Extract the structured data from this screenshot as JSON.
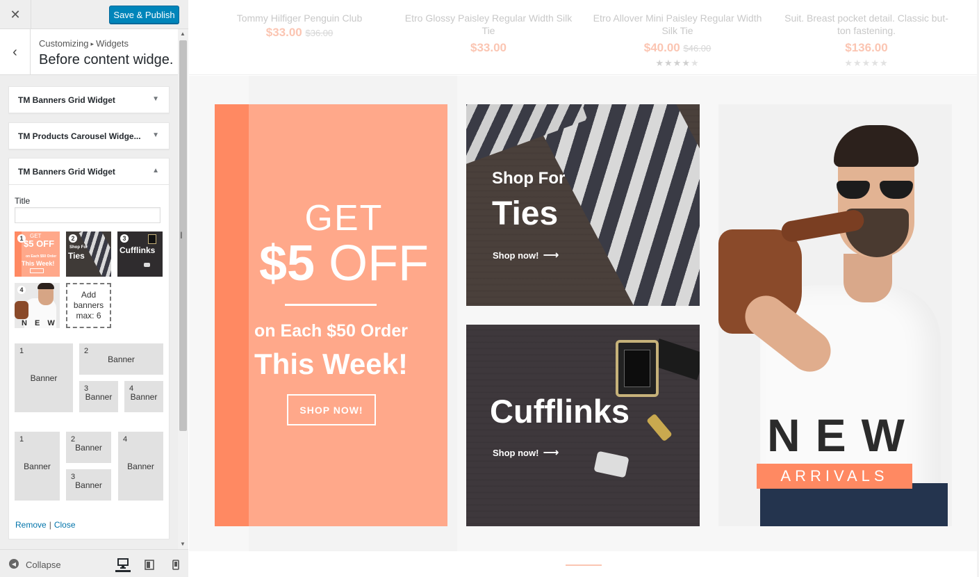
{
  "header": {
    "close_icon": "close-icon",
    "publish_label": "Save & Publish",
    "crumb_root": "Customizing",
    "crumb_sep": "▸",
    "crumb_current": "Widgets",
    "section_title": "Before content widge..."
  },
  "widgets": [
    {
      "title": "TM Banners Grid Widget",
      "expanded": false
    },
    {
      "title": "TM Products Carousel Widge...",
      "expanded": false
    },
    {
      "title": "TM Banners Grid Widget",
      "expanded": true
    }
  ],
  "form": {
    "title_label": "Title",
    "title_value": "",
    "thumbs": [
      {
        "num": "1",
        "line1": "GET",
        "line2": "$5 OFF",
        "line3": "on Each $50 Order",
        "line4": "This Week!"
      },
      {
        "num": "2",
        "line1": "Shop For",
        "line2": "Ties"
      },
      {
        "num": "3",
        "line1": "Cufflinks"
      },
      {
        "num": "4",
        "line1": "N E W"
      }
    ],
    "add_banners": [
      "Add",
      "banners",
      "max: 6"
    ],
    "layout1": [
      {
        "num": "1",
        "label": "Banner"
      },
      {
        "num": "2",
        "label": "Banner"
      },
      {
        "num": "3",
        "label": "Banner"
      },
      {
        "num": "4",
        "label": "Banner"
      }
    ],
    "layout2": [
      {
        "num": "1",
        "label": "Banner"
      },
      {
        "num": "2",
        "label": "Banner"
      },
      {
        "num": "3",
        "label": "Banner"
      },
      {
        "num": "4",
        "label": "Banner"
      }
    ],
    "remove_label": "Remove",
    "link_sep": "|",
    "close_label": "Close"
  },
  "footer": {
    "collapse_label": "Collapse",
    "devices": [
      "desktop-icon",
      "tablet-icon",
      "mobile-icon"
    ]
  },
  "products": [
    {
      "name": "Tommy Hilfiger Penguin Club",
      "price": "$33.00",
      "old_price": "$36.00",
      "rating": null
    },
    {
      "name": "Etro Glossy Paisley Regular Width Silk Tie",
      "price": "$33.00",
      "old_price": "",
      "rating": null
    },
    {
      "name": "Etro Allover Mini Paisley Regular Width Silk Tie",
      "price": "$40.00",
      "old_price": "$46.00",
      "rating": 4
    },
    {
      "name": "Suit. Breast pocket detail. Classic but-ton fastening.",
      "price": "$136.00",
      "old_price": "",
      "rating": 0
    }
  ],
  "banners": {
    "offer": {
      "get": "GET",
      "amount": "$5",
      "off": "OFF",
      "each": "on Each $50 Order",
      "week": "This Week!",
      "button": "SHOP NOW!"
    },
    "ties": {
      "small": "Shop For",
      "big": "Ties",
      "shop": "Shop now!",
      "arrow": "⟶"
    },
    "cufflinks": {
      "title": "Cufflinks",
      "shop": "Shop now!",
      "arrow": "⟶"
    },
    "new_arrivals": {
      "new": "NEW",
      "arrivals": "ARRIVALS"
    }
  },
  "colors": {
    "accent": "#0085ba",
    "coral": "#ffa88a",
    "coral_dark": "#ff8962",
    "link": "#0073aa"
  }
}
